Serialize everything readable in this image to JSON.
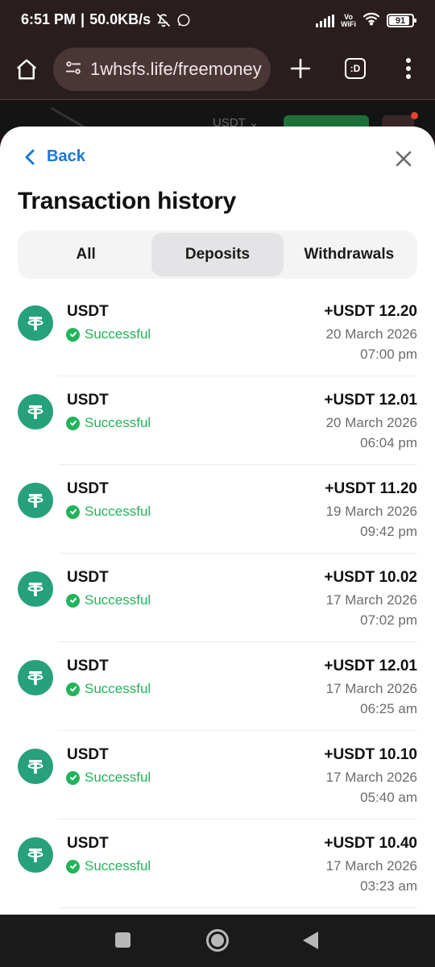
{
  "status_bar": {
    "time": "6:51 PM",
    "separator": "|",
    "net_speed": "50.0KB/s",
    "vowifi_top": "Vo",
    "vowifi_bottom": "WiFi",
    "battery": "91"
  },
  "browser": {
    "url": "1whsfs.life/freemoney",
    "tabs_label": ":D"
  },
  "backdrop": {
    "currency": "USDT ⌄"
  },
  "sheet": {
    "back_label": "Back",
    "title": "Transaction history",
    "tabs": [
      {
        "label": "All",
        "active": false
      },
      {
        "label": "Deposits",
        "active": true
      },
      {
        "label": "Withdrawals",
        "active": false
      }
    ],
    "transactions": [
      {
        "asset": "USDT",
        "status": "Successful",
        "amount": "+USDT 12.20",
        "date": "20 March 2026",
        "time": "07:00 pm"
      },
      {
        "asset": "USDT",
        "status": "Successful",
        "amount": "+USDT 12.01",
        "date": "20 March 2026",
        "time": "06:04 pm"
      },
      {
        "asset": "USDT",
        "status": "Successful",
        "amount": "+USDT 11.20",
        "date": "19 March 2026",
        "time": "09:42 pm"
      },
      {
        "asset": "USDT",
        "status": "Successful",
        "amount": "+USDT 10.02",
        "date": "17 March 2026",
        "time": "07:02 pm"
      },
      {
        "asset": "USDT",
        "status": "Successful",
        "amount": "+USDT 12.01",
        "date": "17 March 2026",
        "time": "06:25 am"
      },
      {
        "asset": "USDT",
        "status": "Successful",
        "amount": "+USDT 10.10",
        "date": "17 March 2026",
        "time": "05:40 am"
      },
      {
        "asset": "USDT",
        "status": "Successful",
        "amount": "+USDT 10.40",
        "date": "17 March 2026",
        "time": "03:23 am"
      }
    ]
  },
  "colors": {
    "accent_blue": "#1877d6",
    "success_green": "#22b45a",
    "tether_green": "#26a17b"
  },
  "icons": {
    "coin": "tether-icon",
    "status": "check-circle-icon",
    "back": "chevron-left-icon",
    "close": "close-icon"
  }
}
